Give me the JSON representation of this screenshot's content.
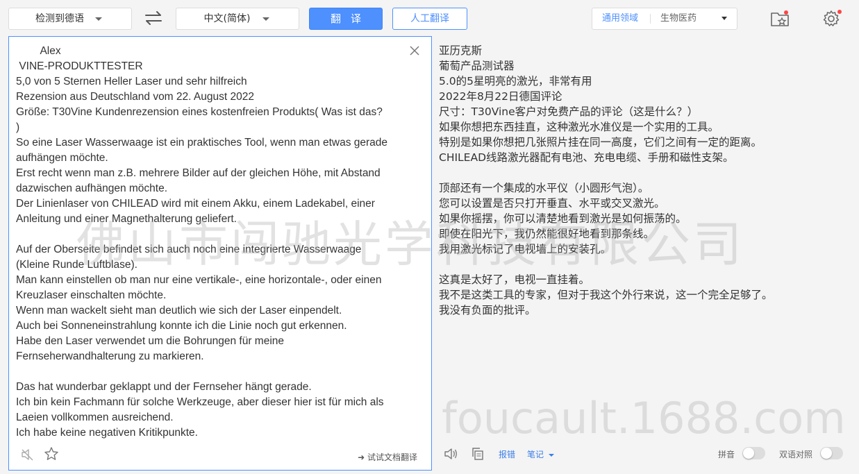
{
  "toolbar": {
    "source_lang": "检测到德语",
    "target_lang": "中文(简体)",
    "translate_label": "翻译",
    "human_translate_label": "人工翻译",
    "domain_general": "通用领域",
    "domain_bio": "生物医药"
  },
  "source": {
    "lines": [
      "        Alex",
      " VINE-PRODUKTTESTER",
      "5,0 von 5 Sternen Heller Laser und sehr hilfreich",
      "Rezension aus Deutschland vom 22. August 2022",
      "Größe: T30Vine Kundenrezension eines kostenfreien Produkts( Was ist das?",
      ")",
      "So eine Laser Wasserwaage ist ein praktisches Tool, wenn man etwas gerade",
      "aufhängen möchte.",
      "Erst recht wenn man z.B. mehrere Bilder auf der gleichen Höhe, mit Abstand",
      "dazwischen aufhängen möchte.",
      "Der Linienlaser von CHILEAD wird mit einem Akku, einem Ladekabel, einer",
      "Anleitung und einer Magnethalterung geliefert.",
      "",
      "Auf der Oberseite befindet sich auch noch eine integrierte Wasserwaage",
      "(Kleine Runde Luftblase).",
      "Man kann einstellen ob man nur eine vertikale-, eine horizontale-, oder einen",
      "Kreuzlaser einschalten möchte.",
      "Wenn man wackelt sieht man deutlich wie sich der Laser einpendelt.",
      "Auch bei Sonneneinstrahlung konnte ich die Linie noch gut erkennen.",
      "Habe den Laser verwendet um die Bohrungen für meine",
      "Fernseherwandhalterung zu markieren.",
      "",
      "Das hat wunderbar geklappt und der Fernseher hängt gerade.",
      "Ich bin kein Fachmann für solche Werkzeuge, aber dieser hier ist für mich als",
      "Laeien vollkommen ausreichend.",
      "Ich habe keine negativen Kritikpunkte."
    ],
    "doc_link": "➜ 试试文档翻译"
  },
  "target": {
    "lines": [
      "亚历克斯",
      "葡萄产品测试器",
      "5.0的5星明亮的激光，非常有用",
      "2022年8月22日德国评论",
      "尺寸：T30Vine客户对免费产品的评论（这是什么？）",
      "如果你想把东西挂直，这种激光水准仪是一个实用的工具。",
      "特别是如果你想把几张照片挂在同一高度，它们之间有一定的距离。",
      "CHILEAD线路激光器配有电池、充电电缆、手册和磁性支架。",
      "",
      "顶部还有一个集成的水平仪（小圆形气泡）。",
      "您可以设置是否只打开垂直、水平或交叉激光。",
      "如果你摇摆，你可以清楚地看到激光是如何振荡的。",
      "即使在阳光下，我仍然能很好地看到那条线。",
      "我用激光标记了电视墙上的安装孔。",
      "",
      "这真是太好了，电视一直挂着。",
      "我不是这类工具的专家，但对于我这个外行来说，这一个完全足够了。",
      "我没有负面的批评。"
    ],
    "report_label": "报错",
    "notes_label": "笔记",
    "pinyin_label": "拼音",
    "bilingual_label": "双语对照"
  },
  "watermark": {
    "company": "佛山市闯驰光学科技有限公司",
    "site": "foucault.1688.com"
  },
  "colors": {
    "accent": "#4d90fe",
    "badge": "#ff4444"
  }
}
